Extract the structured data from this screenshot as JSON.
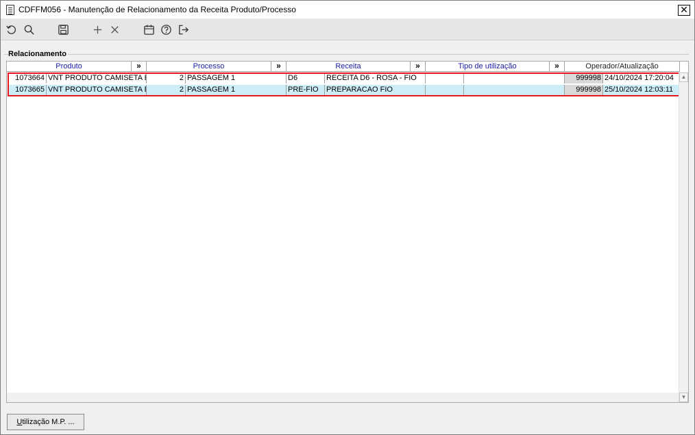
{
  "window": {
    "title": "CDFFM056 - Manutenção de Relacionamento da Receita Produto/Processo",
    "close_glyph": "✕"
  },
  "toolbar": {
    "buttons": [
      {
        "name": "refresh-icon"
      },
      {
        "name": "search-icon"
      },
      {
        "name": "save-icon"
      },
      {
        "name": "add-icon"
      },
      {
        "name": "delete-icon"
      },
      {
        "name": "calendar-icon"
      },
      {
        "name": "help-icon"
      },
      {
        "name": "exit-icon"
      }
    ]
  },
  "group": {
    "label": "Relacionamento"
  },
  "grid": {
    "headers": {
      "produto": "Produto",
      "processo": "Processo",
      "receita": "Receita",
      "tipo": "Tipo de utilização",
      "operador": "Operador/Atualização",
      "more": "»"
    },
    "rows": [
      {
        "produto_code": "1073664",
        "produto_desc": "VNT PRODUTO CAMISETA ES",
        "processo_code": "2",
        "processo_desc": "PASSAGEM 1",
        "receita_code": "D6",
        "receita_desc": "RECEITA D6 - ROSA - FIO",
        "tipo_code": "",
        "tipo_desc": "",
        "operador": "999998",
        "atualizacao": "24/10/2024 17:20:04"
      },
      {
        "produto_code": "1073665",
        "produto_desc": "VNT PRODUTO CAMISETA ES",
        "processo_code": "2",
        "processo_desc": "PASSAGEM 1",
        "receita_code": "PRE-FIO",
        "receita_desc": "PREPARACAO FIO",
        "tipo_code": "",
        "tipo_desc": "",
        "operador": "999998",
        "atualizacao": "25/10/2024 12:03:11"
      }
    ],
    "scroll_up": "▲",
    "scroll_down": "▼"
  },
  "bottom": {
    "button_accel": "U",
    "button_rest": "tilização M.P. ..."
  },
  "colors": {
    "header_text": "#1a1aa6",
    "selected_row": "#cdeef6",
    "highlight_border": "#e8141e",
    "readonly_cell": "#d9d9d9"
  }
}
